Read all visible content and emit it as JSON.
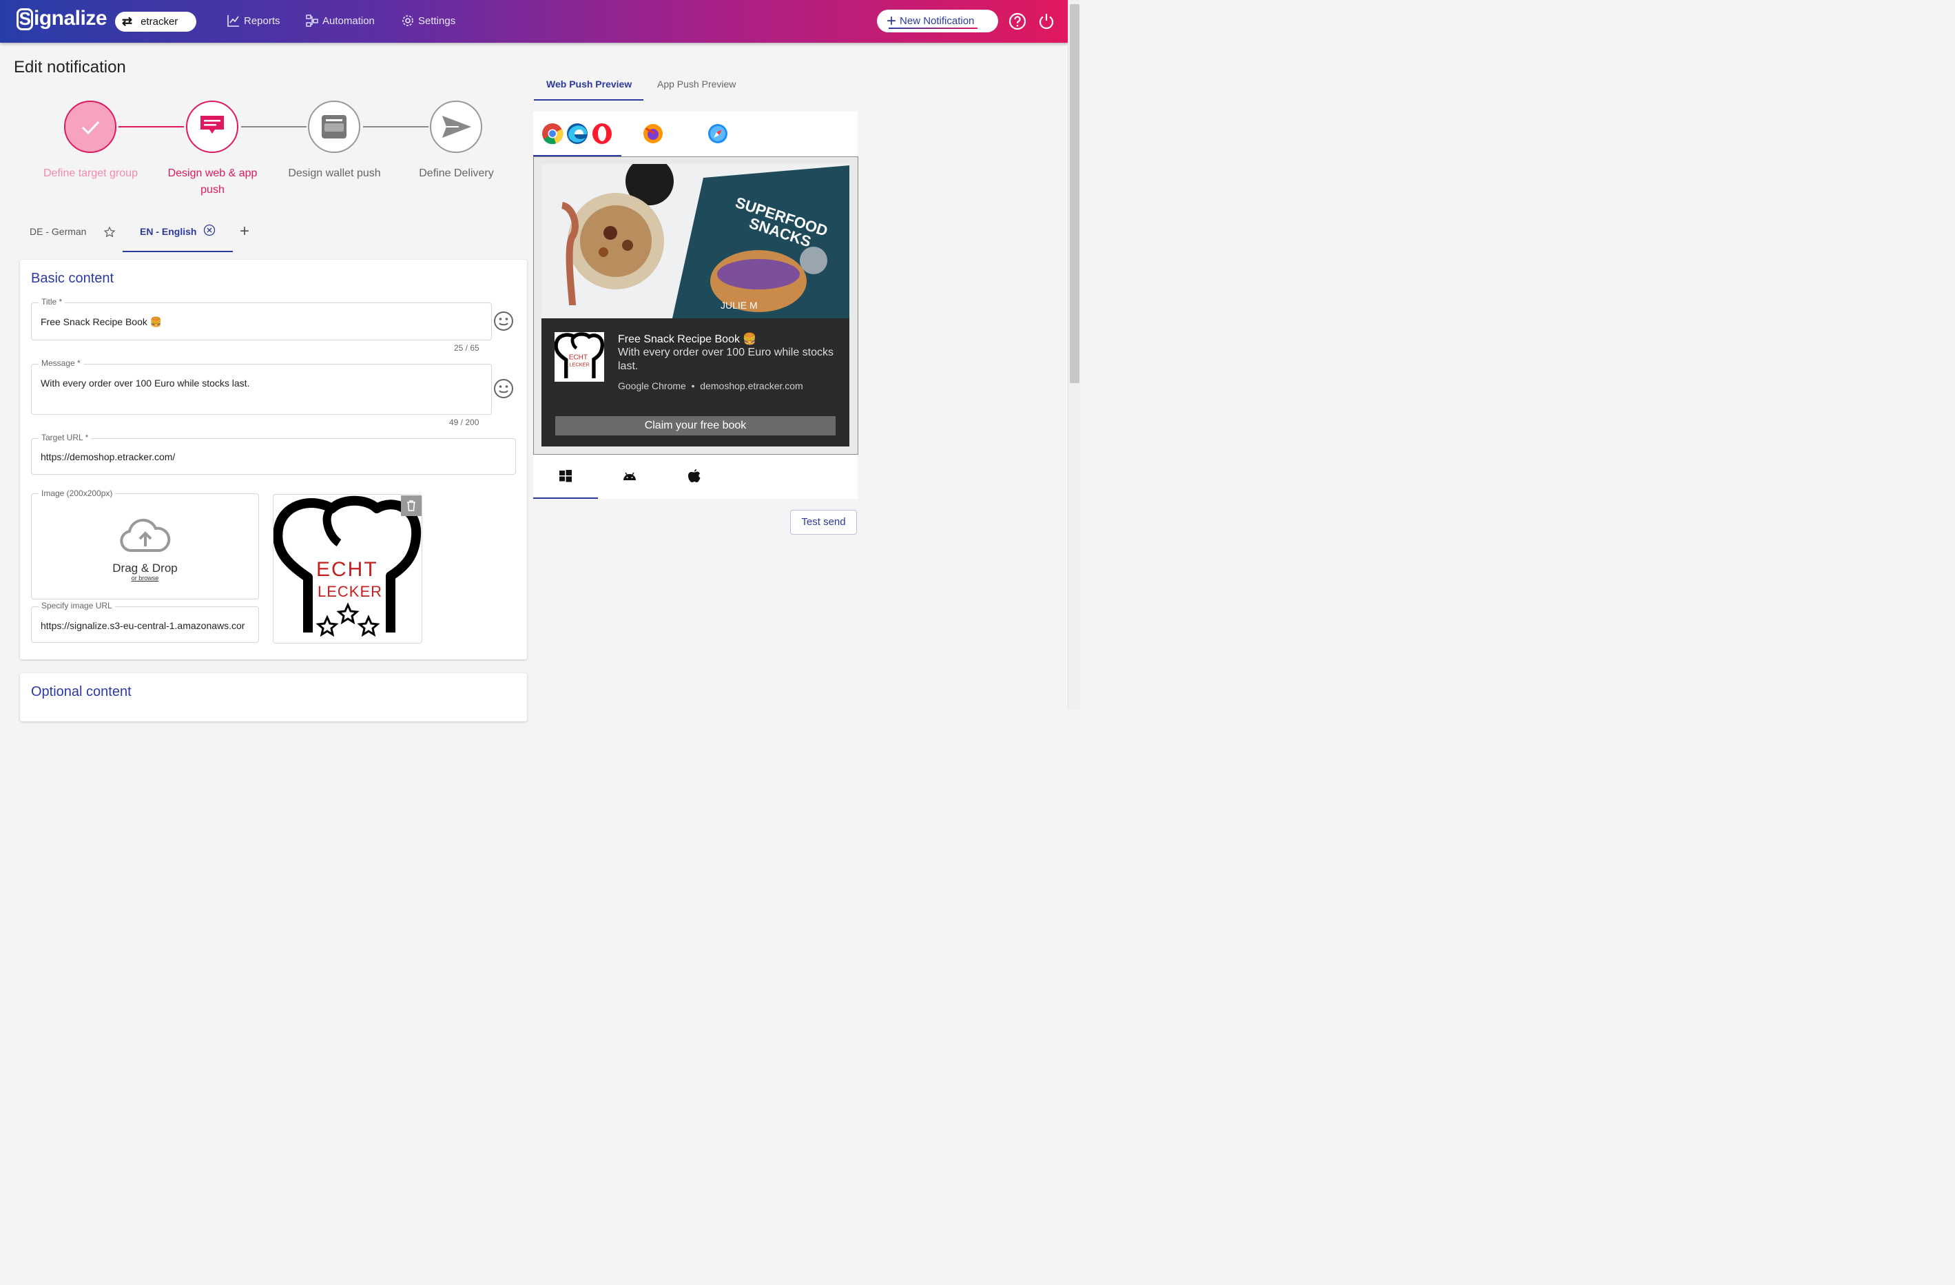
{
  "app": {
    "brand": "ignalize",
    "brand_initial": "S",
    "account": "etracker"
  },
  "nav": {
    "reports": "Reports",
    "automation": "Automation",
    "settings": "Settings"
  },
  "header_actions": {
    "new_notification": "New Notification"
  },
  "page": {
    "title": "Edit notification"
  },
  "steps": [
    {
      "label": "Define target group"
    },
    {
      "label": "Design web & app push"
    },
    {
      "label": "Design wallet push"
    },
    {
      "label": "Define Delivery"
    }
  ],
  "languages": {
    "de": "DE - German",
    "en": "EN - English",
    "add": "+"
  },
  "basic": {
    "section_title": "Basic content",
    "title_label": "Title *",
    "title_value": "Free Snack Recipe Book 🍔",
    "title_counter": "25 / 65",
    "message_label": "Message *",
    "message_value": "With every order over 100 Euro while stocks last.",
    "message_counter": "49 / 200",
    "url_label": "Target URL *",
    "url_value": "https://demoshop.etracker.com/",
    "image_label": "Image (200x200px)",
    "drag_drop": "Drag & Drop",
    "or_browse": "or browse",
    "image_url_label": "Specify image URL",
    "image_url_value": "https://signalize.s3-eu-central-1.amazonaws.cor",
    "logo_line1": "ECHT",
    "logo_line2": "LECKER"
  },
  "optional": {
    "section_title": "Optional content"
  },
  "preview": {
    "tab_web": "Web Push Preview",
    "tab_app": "App Push Preview",
    "book_line1": "SUPERFOOD",
    "book_line2": "SNACKS",
    "book_author": "JULIE M",
    "notif_title": "Free Snack Recipe Book 🍔",
    "notif_message": "With every order over 100 Euro while stocks last.",
    "notif_browser": "Google Chrome",
    "notif_sep": "•",
    "notif_domain": "demoshop.etracker.com",
    "notif_button": "Claim your free book",
    "mini_logo_line1": "ECHT",
    "mini_logo_line2": "LECKER"
  },
  "actions": {
    "test_send": "Test send"
  },
  "colors": {
    "accent": "#2b3a9f",
    "pink": "#e0185f",
    "done": "#f48aab"
  }
}
